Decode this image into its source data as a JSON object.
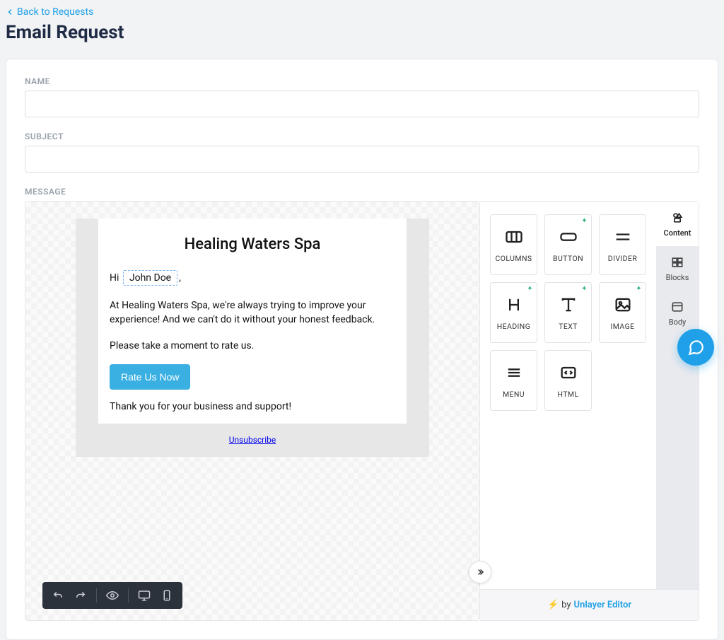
{
  "back_link": "Back to Requests",
  "page_title": "Email Request",
  "form": {
    "name_label": "NAME",
    "name_value": "",
    "subject_label": "SUBJECT",
    "subject_value": "",
    "message_label": "MESSAGE"
  },
  "email": {
    "title": "Healing Waters Spa",
    "greeting_prefix": "Hi",
    "merge_name": "John Doe",
    "greeting_suffix": ",",
    "p1": "At Healing Waters Spa, we're always trying to improve your experience! And we can't do it without your honest feedback.",
    "p2": "Please take a moment to rate us.",
    "button_label": "Rate Us Now",
    "thanks": "Thank you for your business and support!",
    "unsubscribe": "Unsubscribe"
  },
  "panel": {
    "items": {
      "columns": "COLUMNS",
      "button": "BUTTON",
      "divider": "DIVIDER",
      "heading": "HEADING",
      "text": "TEXT",
      "image": "IMAGE",
      "menu": "MENU",
      "html": "HTML"
    },
    "tabs": {
      "content": "Content",
      "blocks": "Blocks",
      "body": "Body"
    },
    "footer_by": "by",
    "footer_brand": "Unlayer Editor"
  }
}
